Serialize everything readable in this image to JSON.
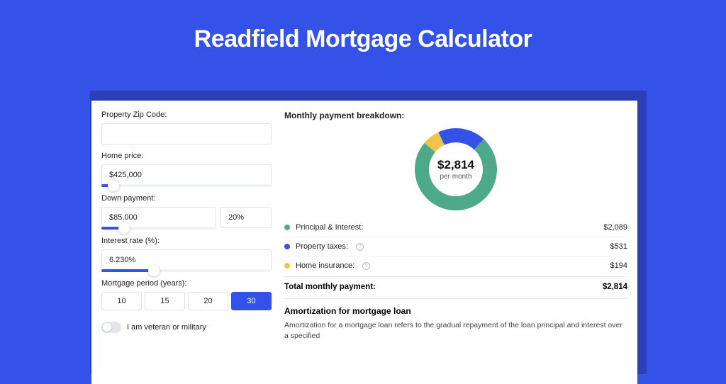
{
  "title": "Readfield Mortgage Calculator",
  "colors": {
    "brand": "#3452e8",
    "principal": "#4ea98b",
    "taxes": "#3452e8",
    "insurance": "#efc44a"
  },
  "form": {
    "zip": {
      "label": "Property Zip Code:",
      "value": ""
    },
    "home_price": {
      "label": "Home price:",
      "value": "$425,000",
      "slider_pct": 7
    },
    "down_payment": {
      "label": "Down payment:",
      "amount": "$85,000",
      "pct": "20%",
      "slider_pct": 20
    },
    "interest_rate": {
      "label": "Interest rate (%):",
      "value": "6.230%",
      "slider_pct": 31
    },
    "period": {
      "label": "Mortgage period (years):",
      "options": [
        "10",
        "15",
        "20",
        "30"
      ],
      "selected": "30"
    },
    "veteran": {
      "label": "I am veteran or military",
      "checked": false
    }
  },
  "breakdown": {
    "title": "Monthly payment breakdown:",
    "center_amount": "$2,814",
    "center_sub": "per month",
    "items": [
      {
        "label": "Principal & Interest:",
        "value": "$2,089",
        "color_key": "principal",
        "help": false
      },
      {
        "label": "Property taxes:",
        "value": "$531",
        "color_key": "taxes",
        "help": true
      },
      {
        "label": "Home insurance:",
        "value": "$194",
        "color_key": "insurance",
        "help": true
      }
    ],
    "total_label": "Total monthly payment:",
    "total_value": "$2,814"
  },
  "chart_data": {
    "type": "pie",
    "title": "Monthly payment breakdown",
    "series": [
      {
        "name": "Principal & Interest",
        "value": 2089,
        "color": "#4ea98b"
      },
      {
        "name": "Property taxes",
        "value": 531,
        "color": "#3452e8"
      },
      {
        "name": "Home insurance",
        "value": 194,
        "color": "#efc44a"
      }
    ],
    "total": 2814,
    "center_label": "$2,814 per month"
  },
  "amortization": {
    "title": "Amortization for mortgage loan",
    "text": "Amortization for a mortgage loan refers to the gradual repayment of the loan principal and interest over a specified"
  }
}
